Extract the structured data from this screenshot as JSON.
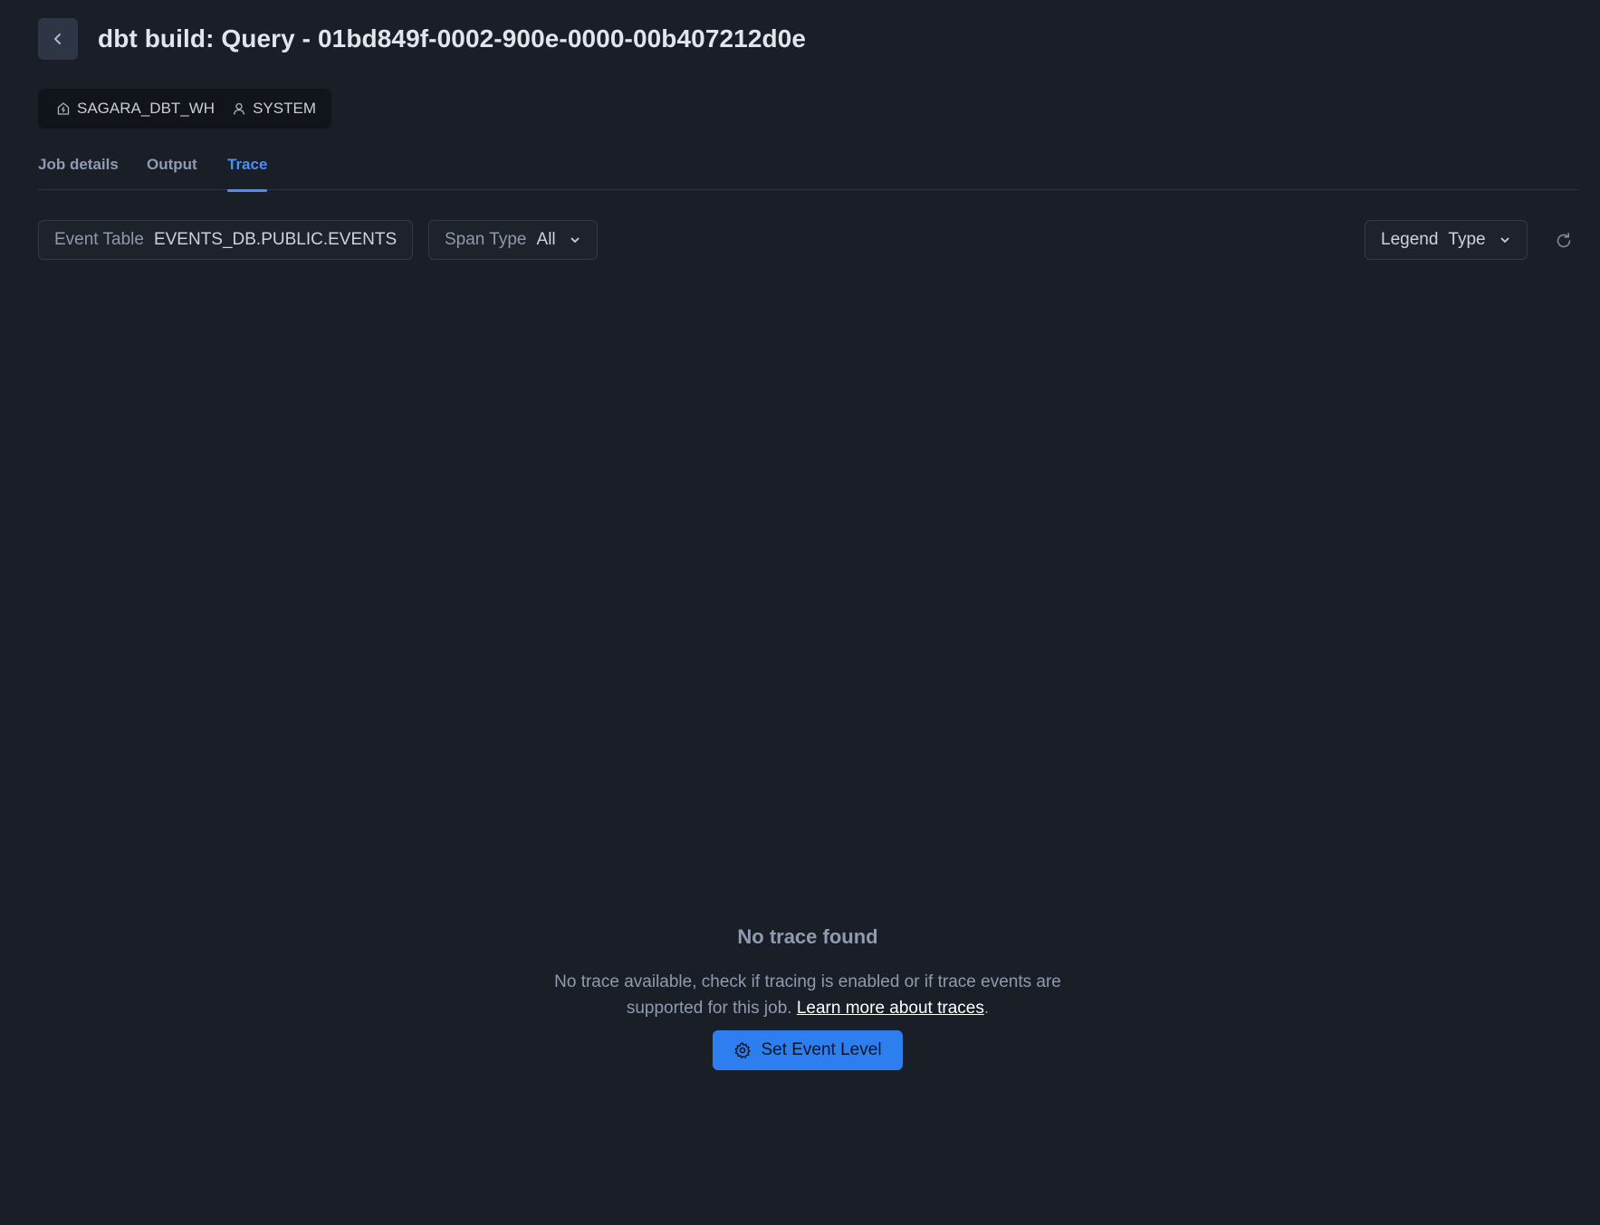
{
  "header": {
    "title": "dbt build: Query - 01bd849f-0002-900e-0000-00b407212d0e",
    "back_icon": "chevron-left-icon"
  },
  "meta": {
    "warehouse": "SAGARA_DBT_WH",
    "warehouse_icon": "warehouse-icon",
    "user": "SYSTEM",
    "user_icon": "user-icon"
  },
  "tabs": [
    {
      "label": "Job details",
      "active": false
    },
    {
      "label": "Output",
      "active": false
    },
    {
      "label": "Trace",
      "active": true
    }
  ],
  "toolbar": {
    "event_table_label": "Event Table",
    "event_table_value": "EVENTS_DB.PUBLIC.EVENTS",
    "span_type_label": "Span Type",
    "span_type_value": "All",
    "legend_label": "Legend",
    "legend_value": "Type",
    "refresh_icon": "refresh-icon"
  },
  "empty_state": {
    "title": "No trace found",
    "message": "No trace available, check if tracing is enabled or if trace events are supported for this job.",
    "link_text": "Learn more about traces",
    "suffix": ".",
    "button_label": "Set Event Level",
    "button_icon": "gear-icon"
  },
  "colors": {
    "background": "#1a1e26",
    "accent": "#4b8ef5",
    "primary_button": "#2d7ff0"
  }
}
